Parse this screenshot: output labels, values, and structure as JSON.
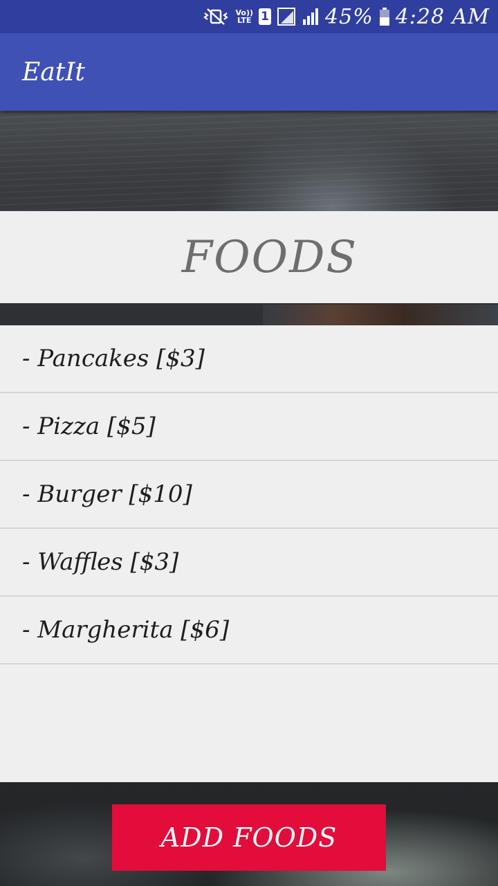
{
  "status_bar": {
    "volte_top": "Vo))",
    "volte_bottom": "LTE",
    "sim_slot": "1",
    "battery_percent": "45%",
    "time": "4:28 AM",
    "icons": [
      "vibrate-mute-icon",
      "volte-icon",
      "sim-icon",
      "signal-icon",
      "signal-icon",
      "battery-icon"
    ]
  },
  "app_bar": {
    "title": "EatIt",
    "color": "#3f51b5",
    "status_color": "#303f9f"
  },
  "section": {
    "title": "FOODS"
  },
  "food_list": {
    "items": [
      {
        "label": "- Pancakes [$3]"
      },
      {
        "label": "- Pizza [$5]"
      },
      {
        "label": "- Burger [$10]"
      },
      {
        "label": "- Waffles [$3]"
      },
      {
        "label": "- Margherita [$6]"
      }
    ]
  },
  "actions": {
    "add_label": "ADD FOODS",
    "add_color": "#e20d3a"
  }
}
